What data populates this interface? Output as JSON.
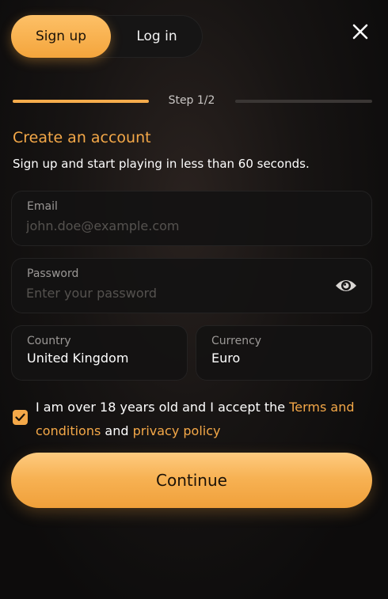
{
  "tabs": {
    "signup_label": "Sign up",
    "login_label": "Log in",
    "active": "Sign up"
  },
  "progress": {
    "step_label": "Step 1/2",
    "fraction_complete": 0.5
  },
  "form": {
    "title": "Create an account",
    "subtitle": "Sign up and start playing in less than 60 seconds.",
    "email": {
      "label": "Email",
      "placeholder": "john.doe@example.com",
      "value": ""
    },
    "password": {
      "label": "Password",
      "placeholder": "Enter your password",
      "value": ""
    },
    "country": {
      "label": "Country",
      "value": "United Kingdom"
    },
    "currency": {
      "label": "Currency",
      "value": "Euro"
    }
  },
  "consent": {
    "checked": true,
    "text_before": "I am over 18 years old and I accept the ",
    "terms_link": "Terms and conditions",
    "text_middle": " and ",
    "privacy_link": "privacy policy"
  },
  "continue_label": "Continue",
  "icons": {
    "close": "close-icon",
    "eye": "eye-icon",
    "check": "checkmark-icon"
  },
  "colors": {
    "accent": "#f4a848",
    "accent_light": "#fdc067",
    "background": "#171413",
    "field_bg": "#141212",
    "muted_text": "#9b9896"
  }
}
